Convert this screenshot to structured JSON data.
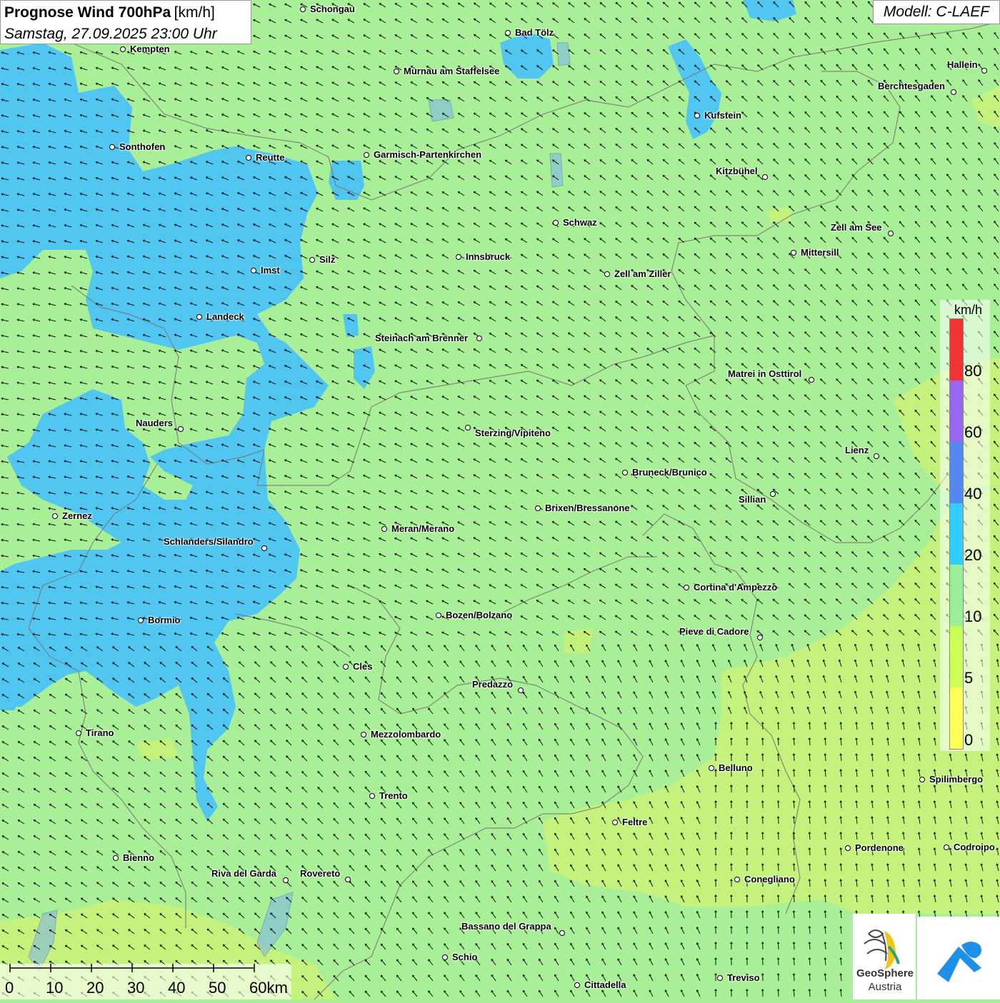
{
  "title": {
    "main": "Prognose Wind 700hPa",
    "unit": "[km/h]",
    "date": "Samstag, 27.09.2025 23:00 Uhr"
  },
  "model": "Modell: C-LAEF",
  "legend": {
    "unit": "km/h",
    "ticks": [
      "80",
      "60",
      "40",
      "20",
      "10",
      "5",
      "0"
    ],
    "colors": [
      "#f03333",
      "#9966ee",
      "#5588ee",
      "#33ccff",
      "#99ee99",
      "#ccff55",
      "#ffff55"
    ]
  },
  "scale_bar": {
    "labels": [
      "0",
      "10",
      "20",
      "30",
      "40",
      "50",
      "60km"
    ]
  },
  "logos": {
    "geosphere_line1": "GeoSphere",
    "geosphere_line2": "Austria"
  },
  "cities": [
    {
      "name": "Schongau"
    },
    {
      "name": "Bad Tölz"
    },
    {
      "name": "Kempten"
    },
    {
      "name": "Murnau am Staffelsee"
    },
    {
      "name": "Hallein"
    },
    {
      "name": "Berchtesgaden"
    },
    {
      "name": "Kufstein"
    },
    {
      "name": "Sonthofen"
    },
    {
      "name": "Reutte"
    },
    {
      "name": "Garmisch-Partenkirchen"
    },
    {
      "name": "Kitzbühel"
    },
    {
      "name": "Schwaz"
    },
    {
      "name": "Zell am See"
    },
    {
      "name": "Mittersill"
    },
    {
      "name": "Silz"
    },
    {
      "name": "Innsbruck"
    },
    {
      "name": "Imst"
    },
    {
      "name": "Zell am Ziller"
    },
    {
      "name": "Landeck"
    },
    {
      "name": "Steinach am Brenner"
    },
    {
      "name": "Matrei in Osttirol"
    },
    {
      "name": "Nauders"
    },
    {
      "name": "Sterzing/Vipiteno"
    },
    {
      "name": "Lienz"
    },
    {
      "name": "Bruneck/Brunico"
    },
    {
      "name": "Sillian"
    },
    {
      "name": "Brixen/Bressanone"
    },
    {
      "name": "Zernez"
    },
    {
      "name": "Meran/Merano"
    },
    {
      "name": "Schlanders/Silandro"
    },
    {
      "name": "Cortina d'Ampezzo"
    },
    {
      "name": "Bozen/Bolzano"
    },
    {
      "name": "Bormio"
    },
    {
      "name": "Pieve di Cadore"
    },
    {
      "name": "Cles"
    },
    {
      "name": "Predazzo"
    },
    {
      "name": "Tirano"
    },
    {
      "name": "Mezzolombardo"
    },
    {
      "name": "Belluno"
    },
    {
      "name": "Spilimbergo"
    },
    {
      "name": "Trento"
    },
    {
      "name": "Feltre"
    },
    {
      "name": "Pordenone"
    },
    {
      "name": "Codroipo"
    },
    {
      "name": "Bienno"
    },
    {
      "name": "Riva del Garda"
    },
    {
      "name": "Rovereto"
    },
    {
      "name": "Conegliano"
    },
    {
      "name": "Bassano del Grappa"
    },
    {
      "name": "Schio"
    },
    {
      "name": "Treviso"
    },
    {
      "name": "Cittadella"
    }
  ]
}
